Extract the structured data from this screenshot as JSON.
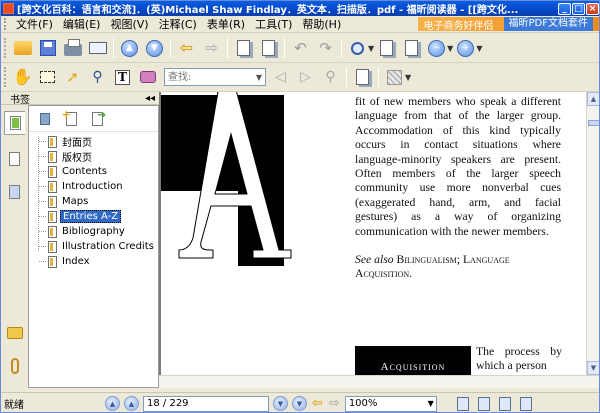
{
  "window": {
    "title": "[跨文化百科：语言和交流]．(英)Michael Shaw Findlay．英文本．扫描版．pdf - 福昕阅读器 - [[跨文化...",
    "min": "_",
    "max": "□",
    "close": "×"
  },
  "menu": {
    "items": [
      "文件(F)",
      "编辑(E)",
      "视图(V)",
      "注释(C)",
      "表单(R)",
      "工具(T)",
      "帮助(H)"
    ],
    "ad1": "电子商务好伴侣",
    "ad2": "福昕PDF文档套件"
  },
  "toolbar": {
    "search_placeholder": "查找:"
  },
  "sidebar": {
    "title": "书签",
    "collapse": "◂◂",
    "bookmarks": [
      {
        "label": "封面页"
      },
      {
        "label": "版权页"
      },
      {
        "label": "Contents"
      },
      {
        "label": "Introduction"
      },
      {
        "label": "Maps"
      },
      {
        "label": "Entries A-Z",
        "selected": true
      },
      {
        "label": "Bibliography"
      },
      {
        "label": "Illustration Credits"
      },
      {
        "label": "Index"
      }
    ]
  },
  "document": {
    "drop_cap": "A",
    "paragraph": "fit of new members who speak a different language from that of the larger group. Accommodation of this kind typically occurs in contact situations where language-minority speakers are present. Often members of the larger speech community use more nonverbal cues (exaggerated hand, arm, and facial gestures) as a way of organizing communication with the newer members.",
    "see_also_label": "See also",
    "see_also_text": "Bilingualism; Language Acquisition.",
    "section_heading": "Acquisition",
    "section_text": "The process by which a person"
  },
  "statusbar": {
    "status": "就绪",
    "page": "18 / 229",
    "zoom": "100%"
  }
}
